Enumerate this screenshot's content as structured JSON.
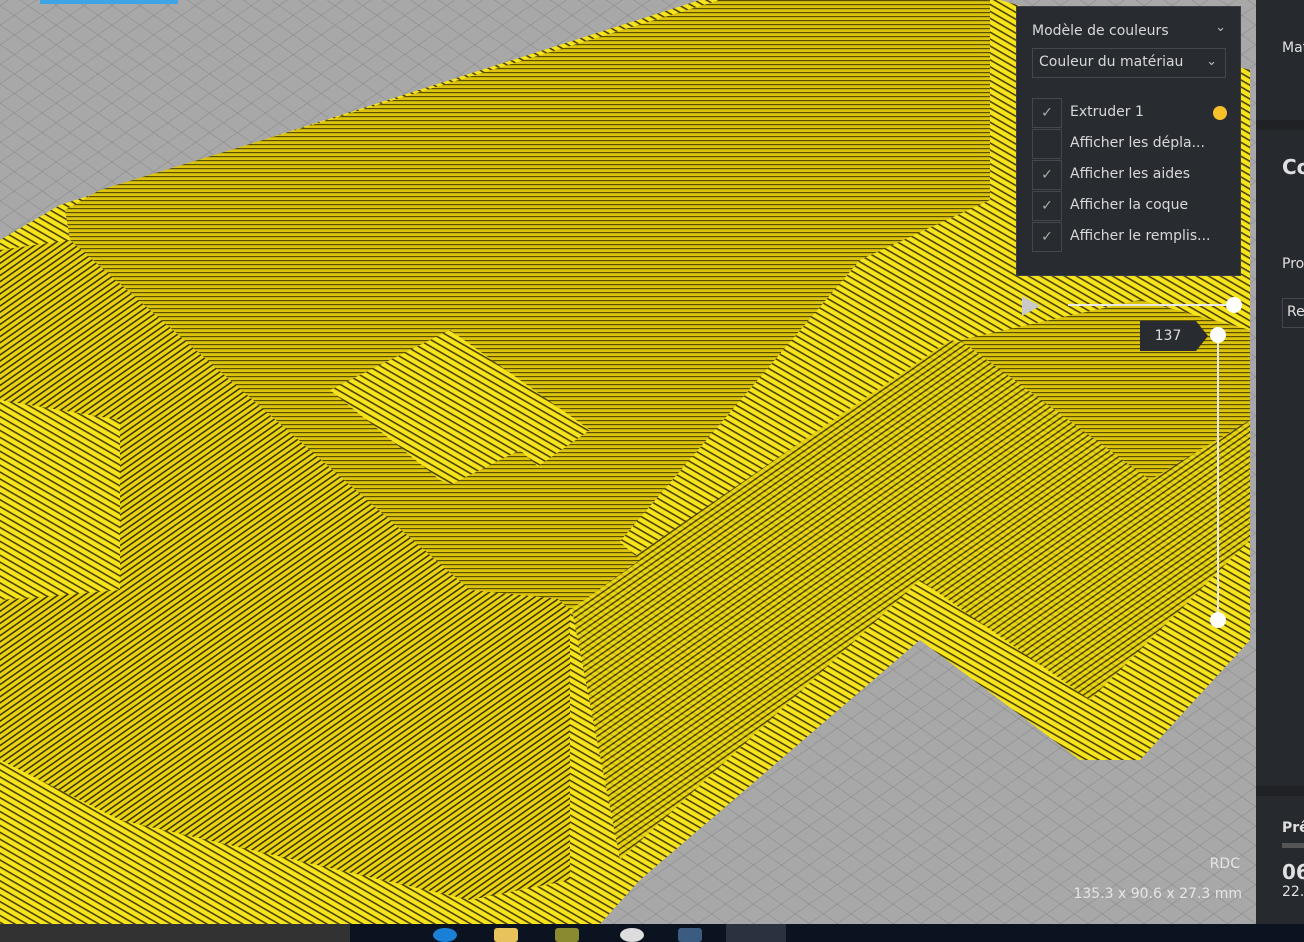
{
  "viewport": {
    "model_color": "#f5e21a",
    "object_name": "RDC",
    "dimensions": "135.3 x 90.6 x 27.3 mm"
  },
  "legend": {
    "header": "Modèle de couleurs",
    "color_scheme": "Couleur du matériau",
    "items": [
      {
        "label": "Extruder 1",
        "checked": true,
        "color": "#f5c02a"
      },
      {
        "label": "Afficher les dépla...",
        "checked": false
      },
      {
        "label": "Afficher les aides",
        "checked": true
      },
      {
        "label": "Afficher la coque",
        "checked": true
      },
      {
        "label": "Afficher le remplis...",
        "checked": true
      }
    ]
  },
  "layer_slider": {
    "current_layer": "137"
  },
  "right_panel": {
    "material_label": "Mat",
    "section_title": "Co",
    "profile_label": "Pro",
    "profile_value": "Re",
    "status": "Prê",
    "time": "06",
    "cost": "22."
  },
  "icons": {
    "check": "✓",
    "chevron": "⌄"
  }
}
